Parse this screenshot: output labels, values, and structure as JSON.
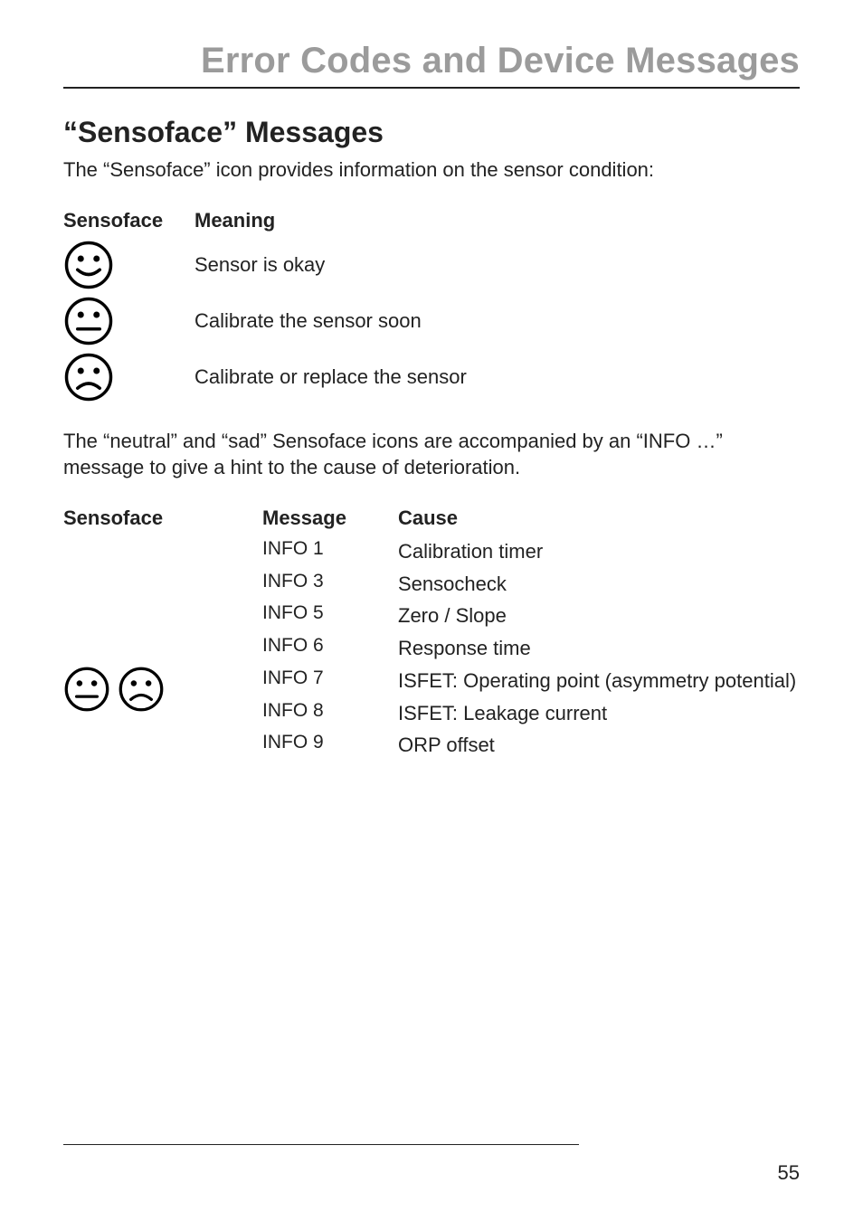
{
  "header": {
    "title": "Error Codes and Device Messages"
  },
  "section1": {
    "heading": "“Sensoface” Messages",
    "intro": "The “Sensoface” icon provides information on the sensor condition:",
    "col_sensoface": "Sensoface",
    "col_meaning": "Meaning",
    "rows": [
      {
        "meaning": "Sensor is okay"
      },
      {
        "meaning": "Calibrate the sensor soon"
      },
      {
        "meaning": "Calibrate or replace the sensor"
      }
    ]
  },
  "note": "The “neutral” and “sad” Sensoface icons are accompanied by an “INFO …” message to give a hint to the cause of deterioration.",
  "table": {
    "col_sensoface": "Sensoface",
    "col_message": "Message",
    "col_cause": "Cause",
    "rows": [
      {
        "message": "INFO 1",
        "cause": "Calibration timer"
      },
      {
        "message": "INFO 3",
        "cause": "Sensocheck"
      },
      {
        "message": "INFO 5",
        "cause": "Zero / Slope"
      },
      {
        "message": "INFO 6",
        "cause": "Response time"
      },
      {
        "message": "INFO 7",
        "cause": "ISFET: Operating point (asymmetry potential)"
      },
      {
        "message": "INFO 8",
        "cause": "ISFET: Leakage current"
      },
      {
        "message": "INFO 9",
        "cause": "ORP offset"
      }
    ]
  },
  "page_number": "55"
}
